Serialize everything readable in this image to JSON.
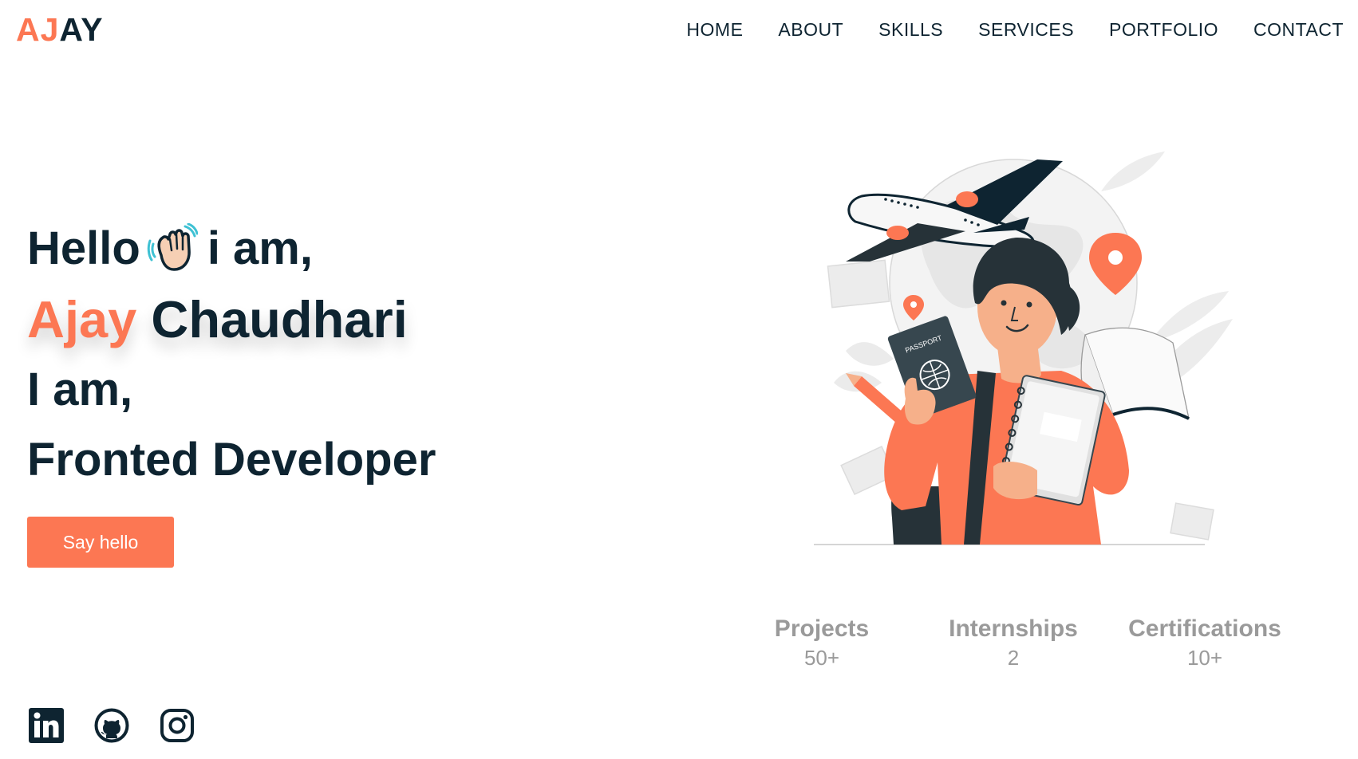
{
  "logo": {
    "part1": "AJ",
    "part2": "AY"
  },
  "nav": [
    "HOME",
    "ABOUT",
    "SKILLS",
    "SERVICES",
    "PORTFOLIO",
    "CONTACT"
  ],
  "hero": {
    "greeting_start": "Hello",
    "greeting_end": "i am,",
    "first_name": "Ajay",
    "last_name": "Chaudhari",
    "line3": "I am,",
    "role": "Fronted Developer",
    "cta": "Say hello"
  },
  "illustration": {
    "passport_text": "PASSPORT"
  },
  "stats": [
    {
      "title": "Projects",
      "value": "50+"
    },
    {
      "title": "Internships",
      "value": "2"
    },
    {
      "title": "Certifications",
      "value": "10+"
    }
  ],
  "social": [
    "linkedin-icon",
    "github-icon",
    "instagram-icon"
  ],
  "colors": {
    "accent": "#fc7753",
    "dark": "#0e2431",
    "muted": "#9a9a9a"
  }
}
